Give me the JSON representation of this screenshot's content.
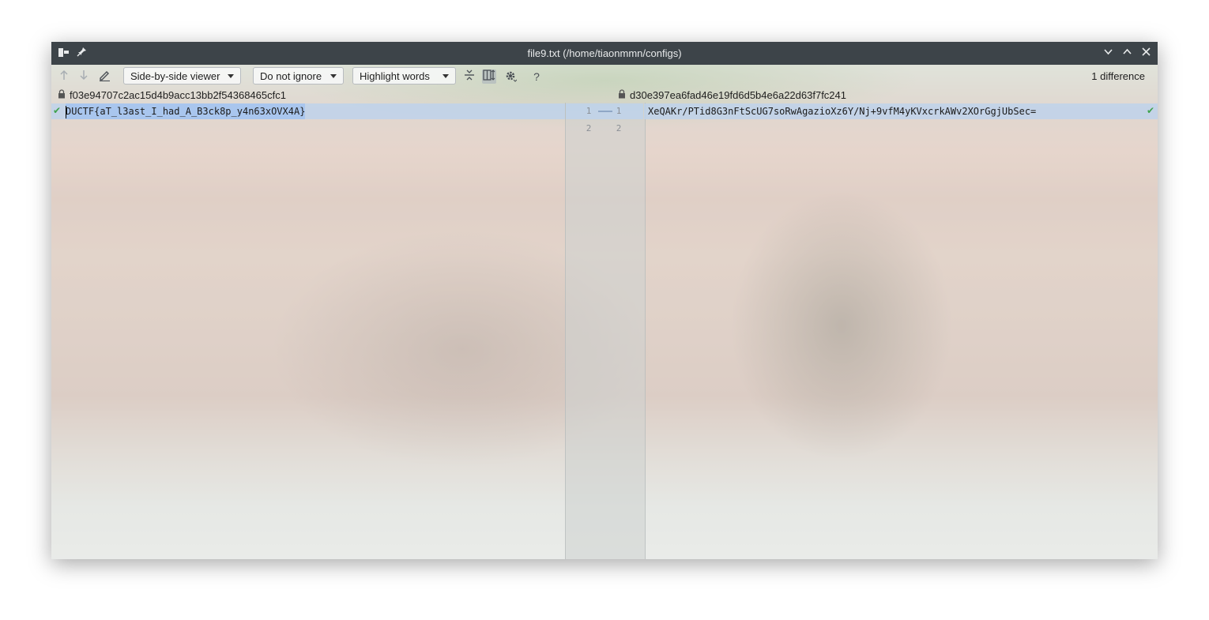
{
  "window": {
    "title": "file9.txt (/home/tiaonmmn/configs)",
    "icons": {
      "app": "app-icon",
      "pin": "pin-icon",
      "minimize": "chevron-down-icon",
      "maximize": "chevron-up-icon",
      "close": "close-icon"
    }
  },
  "toolbar": {
    "prev_icon": "arrow-up-icon",
    "next_icon": "arrow-down-icon",
    "edit_icon": "pencil-icon",
    "viewer_mode": "Side-by-side viewer",
    "ignore_mode": "Do not ignore",
    "highlight_mode": "Highlight words",
    "collapse_icon": "collapse-unchanged-icon",
    "sync_scroll_icon": "sync-scroll-icon",
    "settings_icon": "gear-icon",
    "help_label": "?",
    "difference_count": "1 difference"
  },
  "left_pane": {
    "hash": "f03e94707c2ac15d4b9acc13bb2f54368465cfc1",
    "lines": [
      "DUCTF{aT_l3ast_I_had_A_B3ck8p_y4n63xOVX4A}",
      ""
    ],
    "line_numbers": [
      "1",
      "2"
    ]
  },
  "right_pane": {
    "hash": "d30e397ea6fad46e19fd6d5b4e6a22d63f7fc241",
    "lines": [
      "XeQAKr/PTid8G3nFtScUG7soRwAgazioXz6Y/Nj+9vfM4yKVxcrkAWv2XOrGgjUbSec=",
      ""
    ],
    "line_numbers": [
      "1",
      "2"
    ]
  },
  "colors": {
    "titlebar": "#3d4449",
    "changed_line": "#bed2eb",
    "selection": "#a9c6ee",
    "check": "#3fa34d"
  }
}
